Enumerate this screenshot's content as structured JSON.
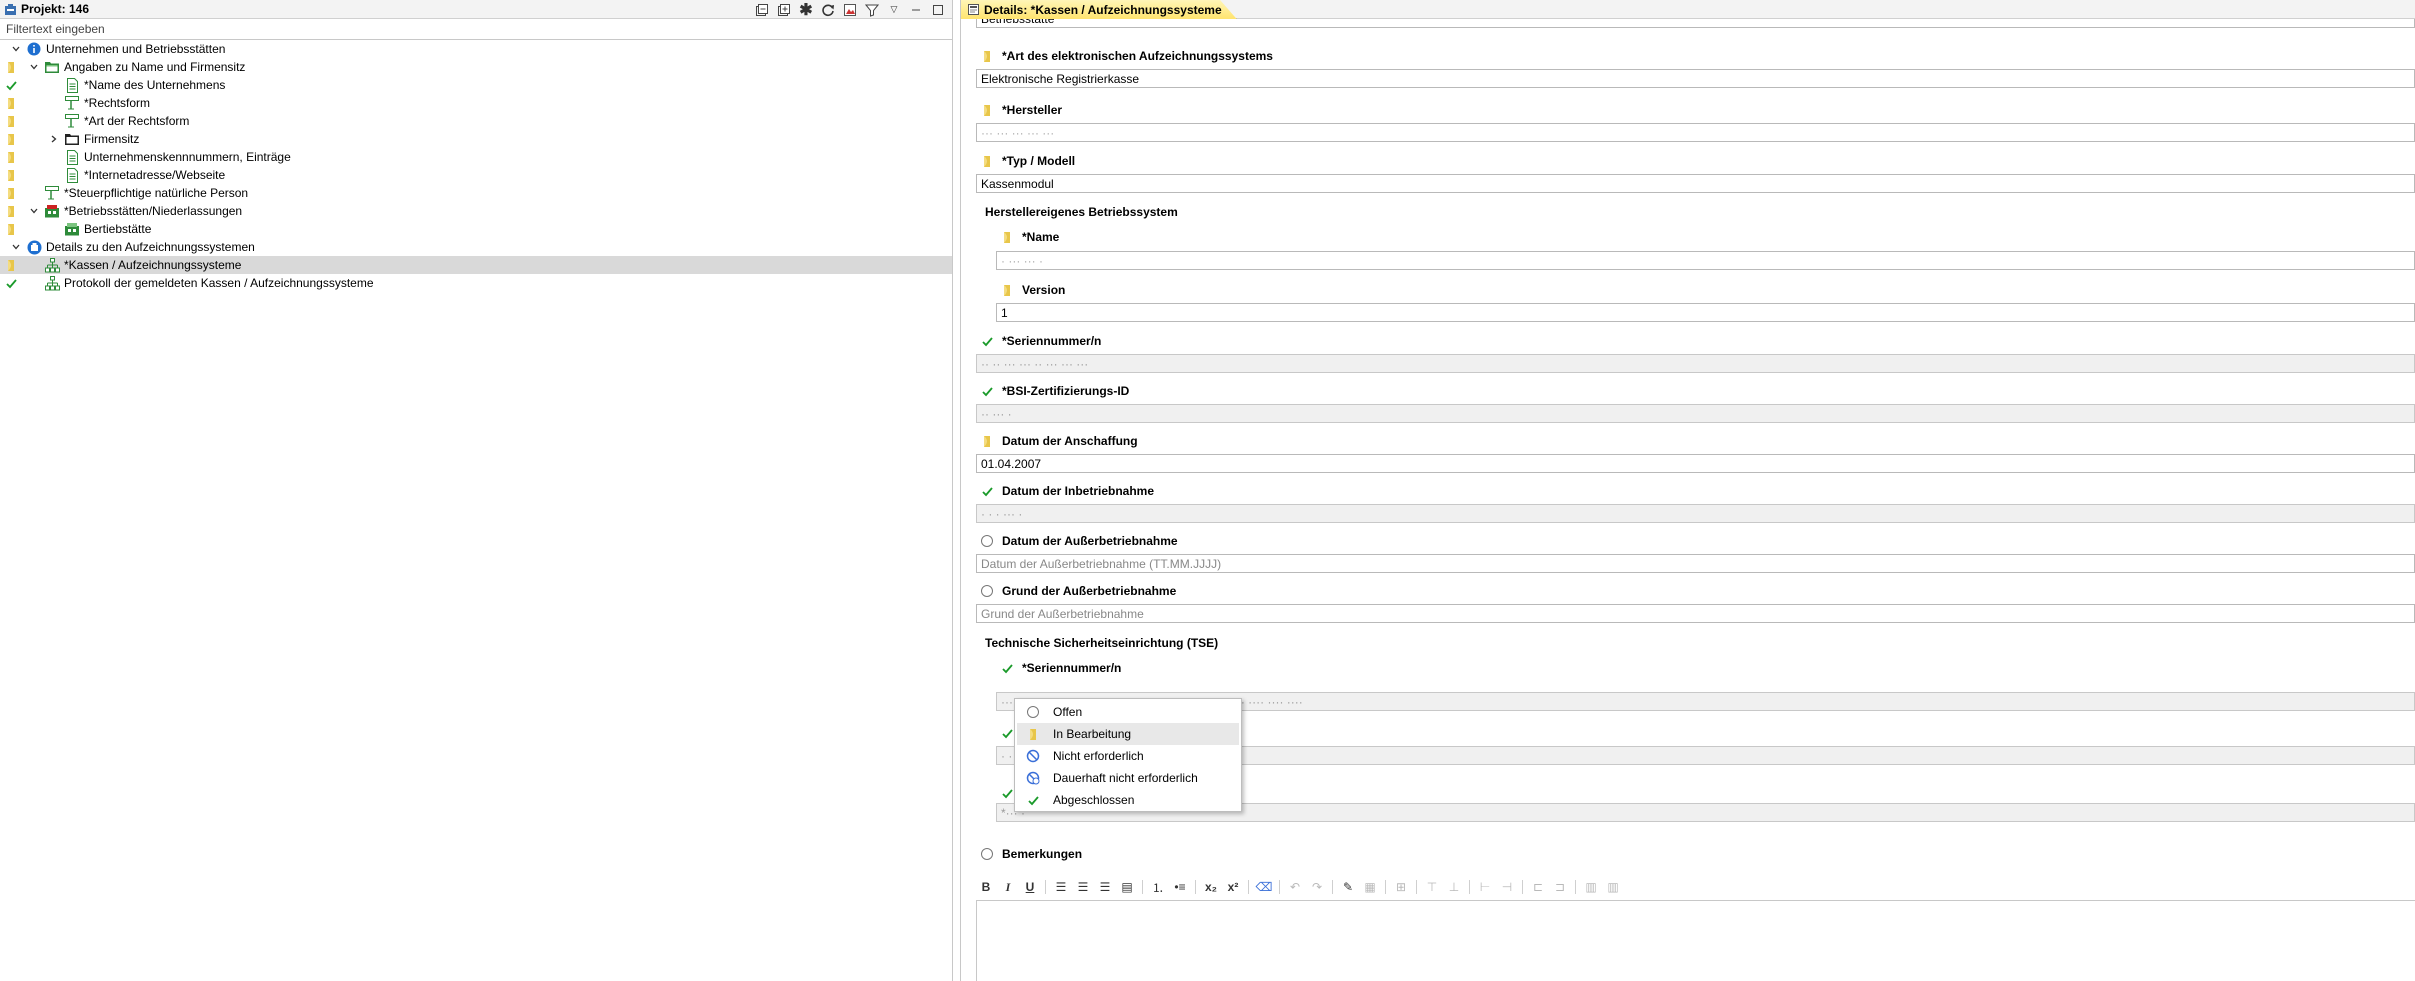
{
  "left": {
    "title": "Projekt: 146",
    "filter_placeholder": "Filtertext eingeben",
    "tree": [
      {
        "label": "Unternehmen und Betriebsstätten",
        "status": "none",
        "icon": "info-icon",
        "expand": "expanded",
        "indent": 0
      },
      {
        "label": "Angaben zu Name und Firmensitz",
        "status": "in-progress",
        "icon": "folder-green-icon",
        "expand": "expanded",
        "indent": 1
      },
      {
        "label": "*Name des Unternehmens",
        "status": "done",
        "icon": "document-icon",
        "expand": "none",
        "indent": 2
      },
      {
        "label": "*Rechtsform",
        "status": "in-progress",
        "icon": "form-icon",
        "expand": "none",
        "indent": 2
      },
      {
        "label": "*Art der Rechtsform",
        "status": "in-progress",
        "icon": "form-icon",
        "expand": "none",
        "indent": 2
      },
      {
        "label": "Firmensitz",
        "status": "in-progress",
        "icon": "folder-icon",
        "expand": "collapsed",
        "indent": 2
      },
      {
        "label": "Unternehmenskennnummern, Einträge",
        "status": "in-progress",
        "icon": "document-icon",
        "expand": "none",
        "indent": 2
      },
      {
        "label": "*Internetadresse/Webseite",
        "status": "in-progress",
        "icon": "document-icon",
        "expand": "none",
        "indent": 2
      },
      {
        "label": "*Steuerpflichtige natürliche Person",
        "status": "in-progress",
        "icon": "form-icon",
        "expand": "none",
        "indent": 1
      },
      {
        "label": "*Betriebsstätten/Niederlassungen",
        "status": "in-progress",
        "icon": "building-red-icon",
        "expand": "expanded",
        "indent": 1
      },
      {
        "label": "Bertiebstätte",
        "status": "in-progress",
        "icon": "building-green-icon",
        "expand": "none",
        "indent": 2
      },
      {
        "label": "Details zu den Aufzeichnungssystemen",
        "status": "none",
        "icon": "cashbox-icon",
        "expand": "expanded",
        "indent": 0
      },
      {
        "label": "*Kassen / Aufzeichnungssysteme",
        "status": "in-progress",
        "icon": "hierarchy-icon",
        "expand": "none",
        "indent": 1,
        "selected": true
      },
      {
        "label": "Protokoll der gemeldeten Kassen / Aufzeichnungssysteme",
        "status": "done",
        "icon": "hierarchy-icon",
        "expand": "none",
        "indent": 1
      }
    ]
  },
  "right": {
    "tab_title": "Details: *Kassen / Aufzeichnungssysteme",
    "top_partial_value": "Betriebsstätte",
    "fields": {
      "art": {
        "label": "*Art des elektronischen Aufzeichnungssystems",
        "value": "Elektronische Registrierkasse"
      },
      "hersteller": {
        "label": "*Hersteller",
        "value": "··· ··· ··· ··· ···"
      },
      "typ": {
        "label": "*Typ / Modell",
        "value": "Kassenmodul"
      },
      "herstellereigen_title": "Herstellereigenes Betriebssystem",
      "name": {
        "label": "*Name",
        "value": "· ··· ··· ·"
      },
      "version": {
        "label": "Version",
        "value": "1"
      },
      "seriennummer": {
        "label": "*Seriennummer/n",
        "value": "·· ·· ··· ··· ·· ··· ··· ···"
      },
      "bsi": {
        "label": "*BSI-Zertifizierungs-ID",
        "value": "·· ··· ·"
      },
      "anschaffung": {
        "label": "Datum der Anschaffung",
        "value": "01.04.2007"
      },
      "inbetrieb": {
        "label": "Datum der Inbetriebnahme",
        "value": "· · · ··· ·"
      },
      "ausserbetrieb": {
        "label": "Datum der Außerbetriebnahme",
        "placeholder": "Datum der Außerbetriebnahme (TT.MM.JJJJ)"
      },
      "grund": {
        "label": "Grund der Außerbetriebnahme",
        "placeholder": "Grund der Außerbetriebnahme"
      },
      "tse_title": "Technische Sicherheitseinrichtung (TSE)",
      "tse_serien": {
        "label": "*Seriennummer/n",
        "value": "··· ···· ···· ···· ···· ···· ···· ···· ···· ···· ···· ···· ···· ···· ···· ····"
      },
      "tse_hidden1": {
        "value": "· ·"
      },
      "tse_hidden2": {
        "value": "*··· ·"
      },
      "bemerkungen": {
        "label": "Bemerkungen"
      }
    }
  },
  "status_menu": [
    {
      "label": "Offen",
      "icon": "circle-open-icon"
    },
    {
      "label": "In Bearbeitung",
      "icon": "pencil-yellow-icon",
      "hover": true
    },
    {
      "label": "Nicht erforderlich",
      "icon": "blocked-icon"
    },
    {
      "label": "Dauerhaft nicht erforderlich",
      "icon": "blocked-permanent-icon"
    },
    {
      "label": "Abgeschlossen",
      "icon": "check-icon"
    }
  ],
  "colors": {
    "check": "#1a9a2a",
    "in_progress": "#e8c64a",
    "blocked": "#3a6fd8",
    "selected_row": "#d9d9d9"
  }
}
